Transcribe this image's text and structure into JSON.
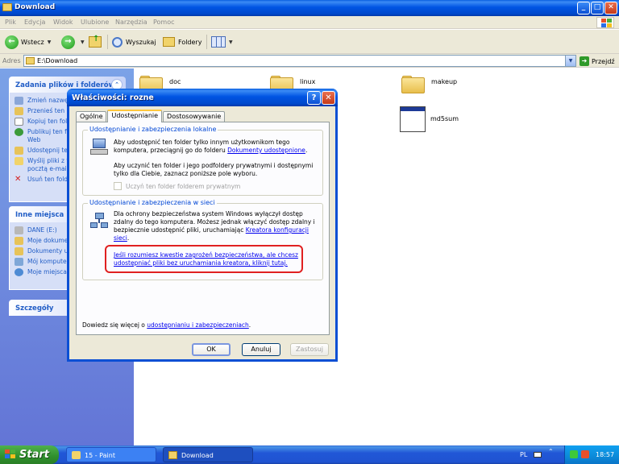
{
  "window": {
    "title": "Download"
  },
  "menu": [
    "Plik",
    "Edycja",
    "Widok",
    "Ulubione",
    "Narzędzia",
    "Pomoc"
  ],
  "toolbar": {
    "back": "Wstecz",
    "search": "Wyszukaj",
    "folders": "Foldery"
  },
  "address": {
    "label": "Adres",
    "value": "E:\\Download",
    "go": "Przejdź"
  },
  "tasks": {
    "files_title": "Zadania plików i folderów",
    "files_items": [
      "Zmień nazwę",
      "Przenieś ten",
      "Kopiuj ten fol",
      "Publikuj ten f Web",
      "Udostępnij te",
      "Wyślij pliki z t pocztą e-mai",
      "Usuń ten fold"
    ],
    "other_title": "Inne miejsca",
    "other_items": [
      "DANE (E:)",
      "Moje dokume",
      "Dokumenty u",
      "Mój kompute",
      "Moje miejsca"
    ],
    "details_title": "Szczegóły"
  },
  "files": [
    {
      "name": "doc",
      "type": "folder"
    },
    {
      "name": "linux",
      "type": "folder"
    },
    {
      "name": "makeup",
      "type": "folder"
    },
    {
      "name": "md5sum",
      "type": "exe"
    }
  ],
  "dialog": {
    "title": "Właściwości: rozne",
    "tabs": [
      "Ogólne",
      "Udostępnianie",
      "Dostosowywanie"
    ],
    "local": {
      "title": "Udostępnianie i zabezpieczenia lokalne",
      "text1": "Aby udostępnić ten folder tylko innym użytkownikom tego komputera, przeciągnij go do folderu",
      "text1_link": "Dokumenty udostępnione",
      "text2": "Aby uczynić ten folder i jego podfoldery prywatnymi i dostępnymi tylko dla Ciebie, zaznacz poniższe pole wyboru.",
      "checkbox": "Uczyń ten folder folderem prywatnym"
    },
    "network": {
      "title": "Udostępnianie i zabezpieczenia w sieci",
      "text": "Dla ochrony bezpieczeństwa system Windows wyłączył dostęp zdalny do tego komputera. Możesz jednak włączyć dostęp zdalny i bezpiecznie udostępnić pliki, uruchamiając",
      "link": "Kreatora konfiguracji sieci",
      "risk_link": "Jeśli rozumiesz kwestie zagrożeń bezpieczeństwa, ale chcesz udostępniać pliki bez uruchamiania kreatora, kliknij tutaj."
    },
    "learn_prefix": "Dowiedz się więcej o",
    "learn_link": "udostępnianiu i zabezpieczeniach",
    "ok": "OK",
    "cancel": "Anuluj",
    "apply": "Zastosuj"
  },
  "taskbar": {
    "start": "Start",
    "tasks": [
      "15 - Paint",
      "Download"
    ],
    "lang": "PL",
    "clock": "18:57"
  }
}
